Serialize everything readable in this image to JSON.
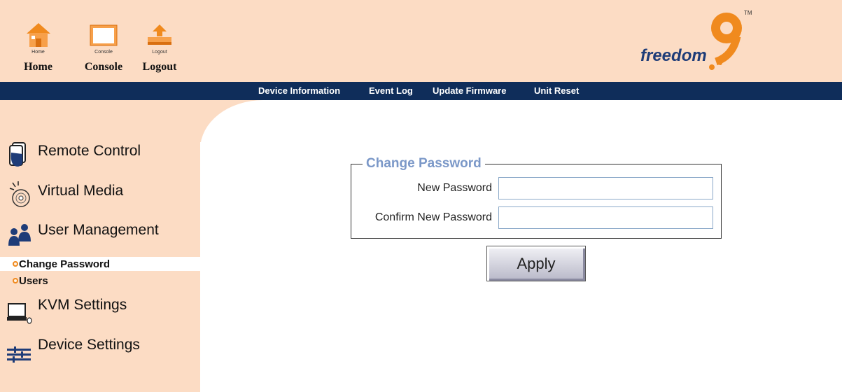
{
  "header": {
    "nav": [
      {
        "id": "home",
        "small_label": "Home",
        "label": "Home"
      },
      {
        "id": "console",
        "small_label": "Console",
        "label": "Console"
      },
      {
        "id": "logout",
        "small_label": "Logout",
        "label": "Logout"
      }
    ],
    "logo": {
      "text": "freedom",
      "digit": "9",
      "tm": "TM"
    }
  },
  "menubar": {
    "items": [
      "Device Information",
      "Event Log",
      "Update Firmware",
      "Unit Reset"
    ]
  },
  "sidebar": {
    "items": [
      {
        "label": "Remote Control",
        "icon": "remote-control-icon"
      },
      {
        "label": "Virtual Media",
        "icon": "virtual-media-icon"
      },
      {
        "label": "User Management",
        "icon": "user-management-icon"
      },
      {
        "label": "KVM Settings",
        "icon": "kvm-settings-icon"
      },
      {
        "label": "Device Settings",
        "icon": "device-settings-icon"
      }
    ],
    "subitems": [
      {
        "label": "Change Password",
        "active": true
      },
      {
        "label": "Users",
        "active": false
      }
    ]
  },
  "form": {
    "legend": "Change Password",
    "new_password_label": "New Password",
    "new_password_value": "",
    "confirm_password_label": "Confirm New Password",
    "confirm_password_value": "",
    "apply_label": "Apply"
  },
  "colors": {
    "header_bg": "#fcdcc4",
    "menubar_bg": "#0f2d5a",
    "accent_orange": "#f08a1e",
    "legend_blue": "#7b98c8",
    "logo_blue": "#1e3c78"
  }
}
